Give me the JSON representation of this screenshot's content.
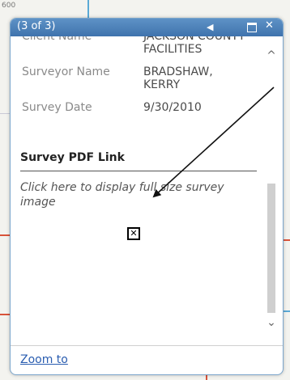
{
  "background": {
    "corner_label": "600"
  },
  "popup": {
    "title": "(3 of 3)",
    "prev_symbol": "◀",
    "close_symbol": "✕",
    "fields": [
      {
        "label": "Client Name",
        "value": "JACKSON COUNTY FACILITIES"
      },
      {
        "label": "Surveyor Name",
        "value": "BRADSHAW, KERRY"
      },
      {
        "label": "Survey Date",
        "value": "9/30/2010"
      }
    ],
    "section_title": "Survey PDF Link",
    "link_text": "Click here to display full size survey image",
    "broken_image_symbol": "✕",
    "scroll_up": "^",
    "scroll_down": "⌄",
    "zoom_to": "Zoom to"
  },
  "colors": {
    "titlebar": "#4a7fb9",
    "link": "#2a5db0"
  }
}
